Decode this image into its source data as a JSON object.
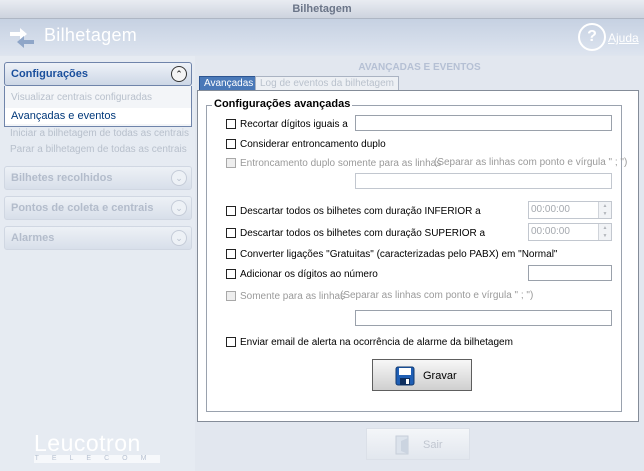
{
  "window": {
    "title": "Bilhetagem"
  },
  "header": {
    "app_title": "Bilhetagem",
    "help_label": "Ajuda"
  },
  "sidebar": {
    "sections": [
      {
        "label": "Configurações"
      },
      {
        "label": "Bilhetes recolhidos"
      },
      {
        "label": "Pontos de coleta e centrais"
      },
      {
        "label": "Alarmes"
      }
    ],
    "items": [
      "Visualizar centrais configuradas",
      "Avançadas e eventos",
      "Iniciar a bilhetagem de todas as centrais",
      "Parar a bilhetagem de todas as centrais"
    ]
  },
  "logo": {
    "main": "Leucotron",
    "sub": "TELECOM"
  },
  "main": {
    "page_title": "AVANÇADAS E EVENTOS",
    "tabs": [
      "Avançadas",
      "Log de eventos da bilhetagem"
    ]
  },
  "group": {
    "title": "Configurações avançadas",
    "options": [
      "Recortar dígitos iguais a",
      "Considerar entroncamento duplo",
      "Entroncamento duplo somente para as linhas",
      "Descartar todos os bilhetes com duração INFERIOR a",
      "Descartar todos os bilhetes com duração SUPERIOR a",
      "Converter ligações \"Gratuitas\" (caracterizadas pelo PABX) em \"Normal\"",
      "Adicionar os dígitos ao número",
      "Somente para as linhas",
      "Enviar email de alerta na ocorrência de alarme da bilhetagem"
    ],
    "hint_lines": "(Separar as linhas com ponto e vírgula \" ; \")",
    "time_inferior": "00:00:00",
    "time_superior": "00:00:00"
  },
  "buttons": {
    "save": "Gravar",
    "exit": "Sair"
  }
}
